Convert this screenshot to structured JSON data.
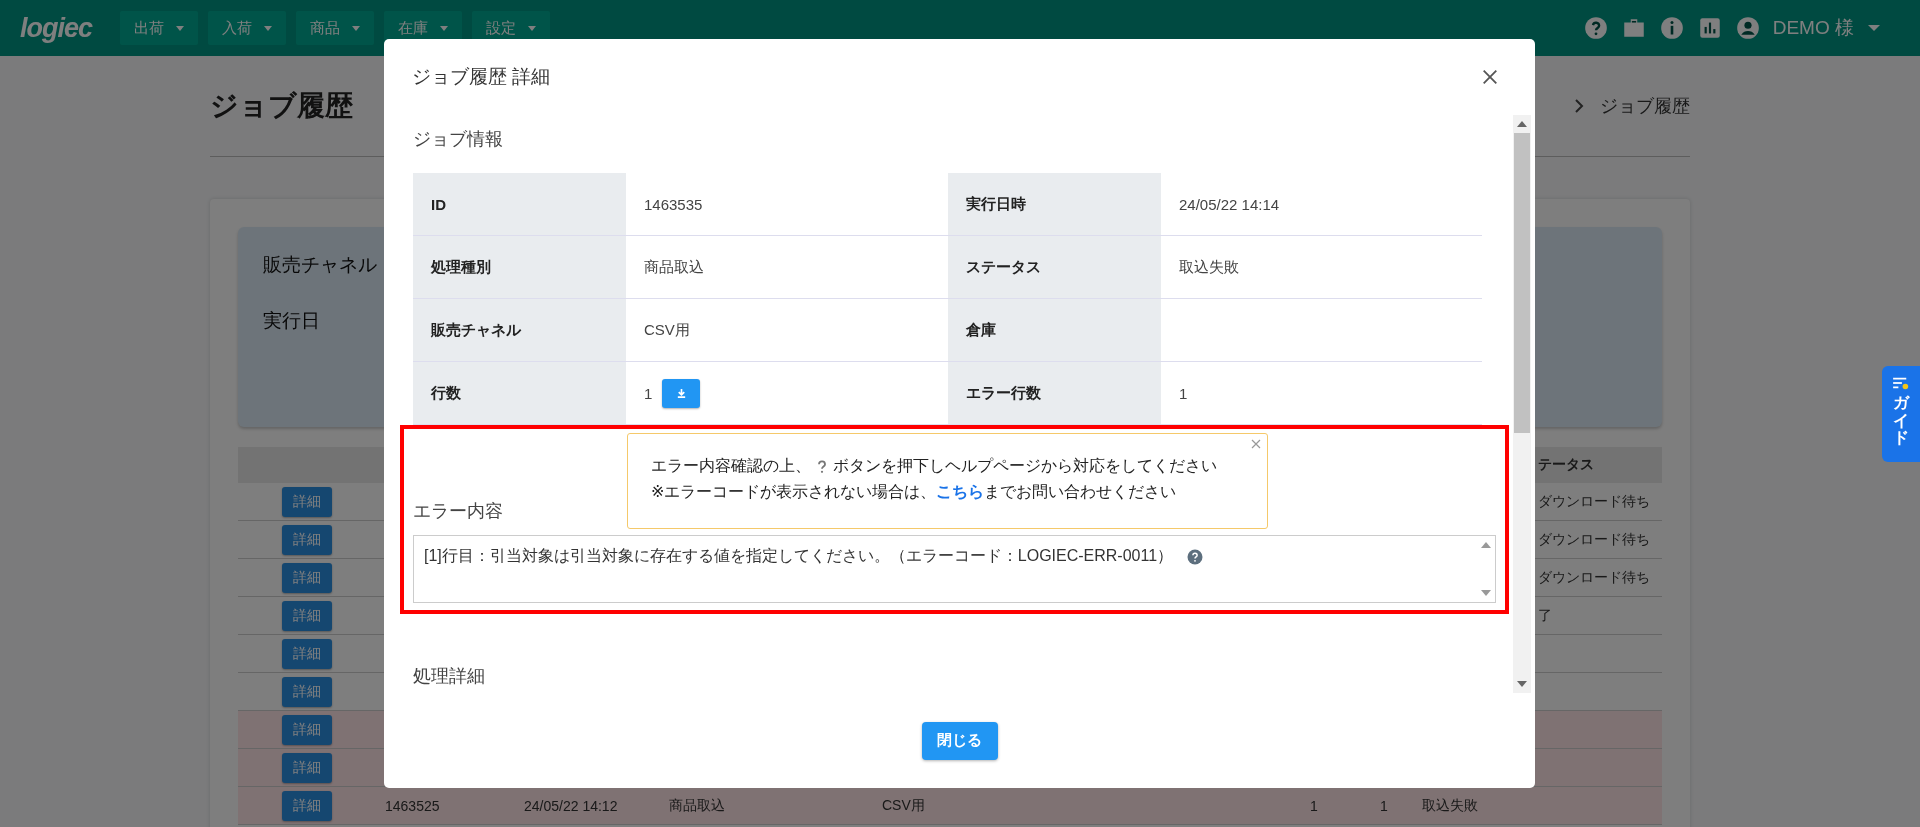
{
  "navbar": {
    "logo": "logiec",
    "menus": [
      {
        "label": "出荷"
      },
      {
        "label": "入荷"
      },
      {
        "label": "商品"
      },
      {
        "label": "在庫"
      },
      {
        "label": "設定"
      }
    ],
    "user": "DEMO 様"
  },
  "page": {
    "title": "ジョブ履歴",
    "breadcrumb": "ジョブ履歴",
    "filters": [
      "販売チャネル",
      "実行日"
    ],
    "table": {
      "status_header": "テータス",
      "rows": [
        {
          "button": "詳細",
          "error": false,
          "status": "ダウンロード待ち"
        },
        {
          "button": "詳細",
          "error": false,
          "status": "ダウンロード待ち"
        },
        {
          "button": "詳細",
          "error": false,
          "status": "ダウンロード待ち"
        },
        {
          "button": "詳細",
          "error": false,
          "status": "了"
        },
        {
          "button": "詳細",
          "error": false
        },
        {
          "button": "詳細",
          "error": false
        },
        {
          "button": "詳細",
          "error": true
        },
        {
          "button": "詳細",
          "error": true
        },
        {
          "button": "詳細",
          "error": true,
          "cells": [
            "1463525",
            "24/05/22 14:12",
            "商品取込",
            "CSV用",
            "1",
            "1",
            "取込失敗"
          ]
        }
      ]
    }
  },
  "modal": {
    "title": "ジョブ履歴 詳細",
    "section": "ジョブ情報",
    "info": [
      {
        "label": "ID",
        "value": "1463535"
      },
      {
        "label": "実行日時",
        "value": "24/05/22 14:14"
      },
      {
        "label": "処理種別",
        "value": "商品取込"
      },
      {
        "label": "ステータス",
        "value": "取込失敗"
      },
      {
        "label": "販売チャネル",
        "value": "CSV用"
      },
      {
        "label": "倉庫"
      },
      {
        "label": "行数",
        "value": "1",
        "download": true
      },
      {
        "label": "エラー行数",
        "value": "1"
      }
    ],
    "notice": {
      "line1_before": "エラー内容確認の上、",
      "line1_after": "ボタンを押下しヘルプページから対応をしてください",
      "line2_before": "※エラーコードが表示されない場合は、",
      "link": "こちら",
      "line2_after": "までお問い合わせください"
    },
    "error_label": "エラー内容",
    "error_text": "[1]行目：引当対象は引当対象に存在する値を指定してください。（エラーコード：LOGIEC-ERR-0011）",
    "section2": "処理詳細",
    "close_button": "閉じる"
  },
  "guide": "ガイド"
}
